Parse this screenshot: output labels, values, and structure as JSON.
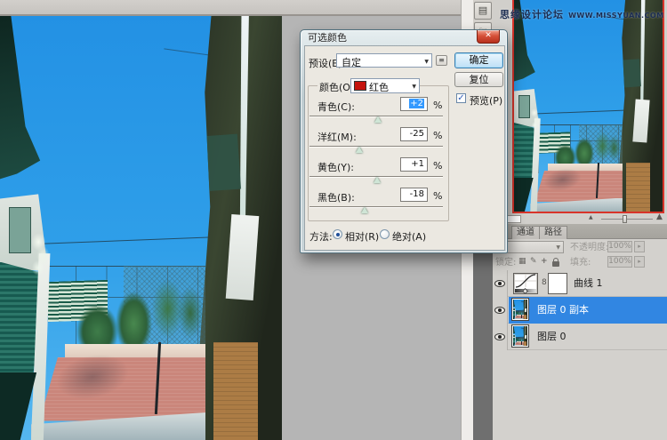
{
  "watermark": {
    "site_name": "思缘设计论坛",
    "site_url": "WWW.MISSYUAN.COM"
  },
  "dialog": {
    "title": "可选颜色",
    "preset": {
      "label": "预设(E):",
      "value": "自定"
    },
    "buttons": {
      "ok": "确定",
      "reset": "复位"
    },
    "preview": {
      "label": "预览(P)",
      "checked": true
    },
    "color": {
      "label": "颜色(O):",
      "value": "红色",
      "swatch": "#c5140e"
    },
    "sliders": [
      {
        "label": "青色(C):",
        "value": "+2",
        "unit": "%",
        "selected": true
      },
      {
        "label": "洋红(M):",
        "value": "-25",
        "unit": "%",
        "selected": false
      },
      {
        "label": "黄色(Y):",
        "value": "+1",
        "unit": "%",
        "selected": false
      },
      {
        "label": "黑色(B):",
        "value": "-18",
        "unit": "%",
        "selected": false
      }
    ],
    "method": {
      "label": "方法:",
      "options": [
        {
          "label": "相对(R)",
          "selected": true
        },
        {
          "label": "绝对(A)",
          "selected": false
        }
      ]
    }
  },
  "navigator": {
    "zoom_value": ""
  },
  "panel": {
    "tabs": [
      {
        "label": "通道"
      },
      {
        "label": "路径"
      }
    ],
    "opacity": {
      "label": "不透明度:",
      "value": "100%"
    },
    "lock": {
      "label": "锁定:"
    },
    "fill": {
      "label": "填充:",
      "value": "100%"
    },
    "layers": [
      {
        "name": "曲线 1",
        "type": "curves-adjustment",
        "visible": true,
        "selected": false
      },
      {
        "name": "图层 0 副本",
        "type": "image",
        "visible": true,
        "selected": true
      },
      {
        "name": "图层 0",
        "type": "image",
        "visible": true,
        "selected": false
      }
    ]
  },
  "icons": {
    "close": "✕",
    "check": "✓",
    "dropdown_arrow": "▼",
    "spin": "▸",
    "preset_menu": "≡",
    "dock_panel": "▤",
    "dock_hand": "☞",
    "mountain_small": "▲",
    "mountain_large": "▲",
    "lock_transparency": "▦",
    "lock_brush": "✎",
    "lock_move": "+",
    "link": "8"
  },
  "colors": {
    "selected_layer": "#3186e2",
    "value_selection": "#3399ff",
    "nav_viewbox_red": "#d8342a",
    "sky": "#2f9fe9",
    "ok_focus_border": "#3c7fb1"
  }
}
